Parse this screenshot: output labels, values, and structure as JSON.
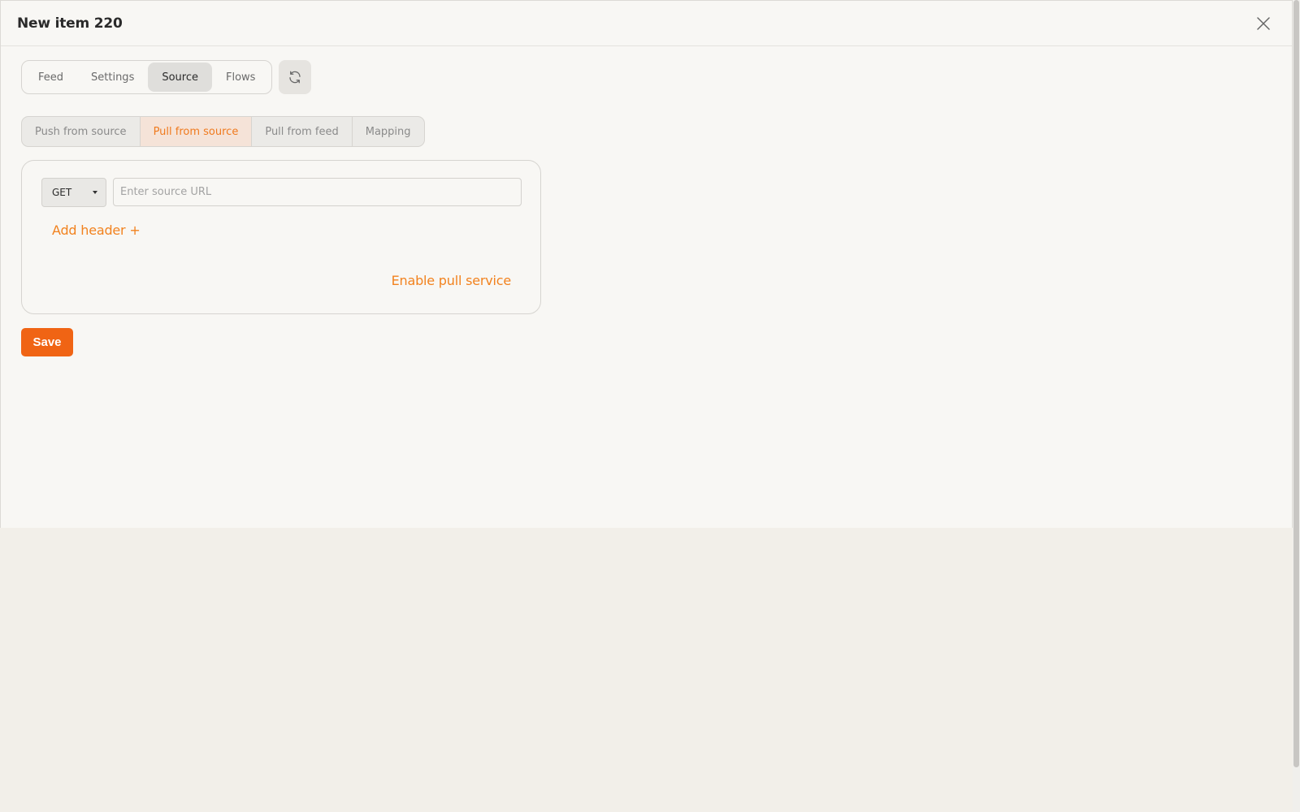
{
  "modal": {
    "title": "New item 220",
    "close_icon": "close-icon"
  },
  "tabs": [
    {
      "label": "Feed",
      "active": false
    },
    {
      "label": "Settings",
      "active": false
    },
    {
      "label": "Source",
      "active": true
    },
    {
      "label": "Flows",
      "active": false
    }
  ],
  "refresh_icon": "refresh-icon",
  "subtabs": [
    {
      "label": "Push from source",
      "active": false
    },
    {
      "label": "Pull from source",
      "active": true
    },
    {
      "label": "Pull from feed",
      "active": false
    },
    {
      "label": "Mapping",
      "active": false
    }
  ],
  "panel": {
    "method": "GET",
    "url_value": "",
    "url_placeholder": "Enter source URL",
    "add_header": "Add header +",
    "enable_pull": "Enable pull service"
  },
  "save_label": "Save",
  "colors": {
    "accent": "#f2821e",
    "save_button": "#f06414",
    "active_subtab_bg": "#f5e3d8"
  }
}
